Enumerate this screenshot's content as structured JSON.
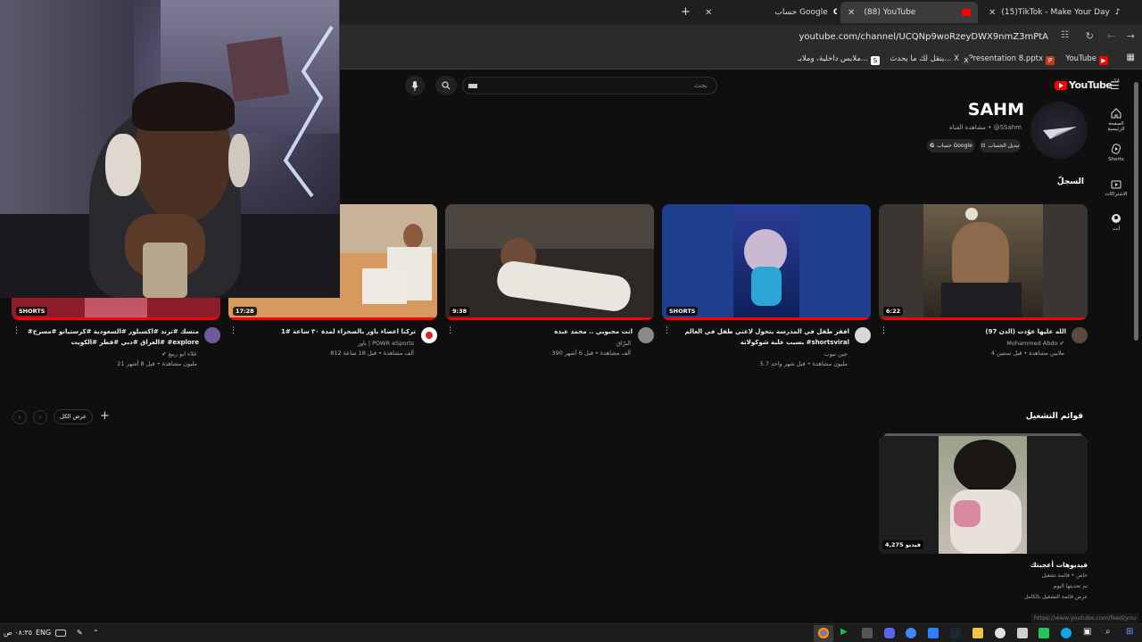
{
  "browser": {
    "tabs": [
      {
        "title": "(15)TikTok - Make Your Day",
        "active": false
      },
      {
        "title": "(88) YouTube",
        "active": true
      },
      {
        "title": "حساب Google",
        "active": false
      }
    ],
    "new_tab": "+",
    "url": "youtube.com/channel/UCQNp9woRzeyDWX9nmZ3mPtA",
    "bookmarks": [
      {
        "label": "YouTube",
        "icon": "youtube-icon"
      },
      {
        "label": "Presentation 8.pptx",
        "icon": "powerpoint-icon"
      },
      {
        "label": "ينقل لك ما يحدث... X",
        "icon": "x-icon"
      },
      {
        "label": "ملابس داخلية، وملابـ...",
        "icon": "s-icon"
      }
    ]
  },
  "youtube": {
    "logo": "YouTube",
    "logo_region": "SA",
    "search_placeholder": "بحث"
  },
  "sidebar": [
    {
      "label": "الصفحة الرئيسية",
      "icon": "home-icon"
    },
    {
      "label": "Shorts",
      "icon": "shorts-icon"
    },
    {
      "label": "الاشتراكات",
      "icon": "subscriptions-icon"
    },
    {
      "label": "أنت",
      "icon": "you-icon"
    }
  ],
  "channel": {
    "name": "SAHM",
    "handle": "@SSahm",
    "view_channel": "مشاهدة القناة",
    "switch_account": "تبديل الحساب",
    "google_account": "حساب Google"
  },
  "history": {
    "title": "السجلّ",
    "videos": [
      {
        "title": "الله عليها عوّدت (الدن 97)",
        "channel": "Mohammed Abdo",
        "verified": true,
        "meta": "4 ملايين مشاهدة • قبل سنتين",
        "duration": "6:22",
        "progress": 1.0
      },
      {
        "title": "افقر طفل في المدرسة يتحول لاغني طفل في العالم بسبب علبة شوكولاتة #shortsviral",
        "channel": "جين تيوب",
        "verified": false,
        "meta": "5.7 مليون مشاهدة • قبل شهر واحد",
        "duration": "SHORTS",
        "progress": 1.0
      },
      {
        "title": "انت محبوبي .. محمد عبده",
        "channel": "البرّاق",
        "verified": false,
        "meta": "390 ألف مشاهدة • قبل 6 أشهر",
        "duration": "9:38",
        "progress": 1.0
      },
      {
        "title": "تركنا اعضاء باور بالصحراء لمدة ٣٠ ساعة #1",
        "channel": "باور | POWR eSports",
        "verified": false,
        "meta": "812 ألف مشاهدة • قبل 18 ساعة",
        "duration": "17:28",
        "progress": 1.0
      },
      {
        "title": "#متسك #ترند #اكسبلور #السعودية #كرستيانو #مسرح #العراق #دبي #قطر #الكويت #explore",
        "channel": "علاء ابو ربيع",
        "verified": true,
        "meta": "21 مليون مشاهدة • قبل 8 أشهر",
        "duration": "SHORTS",
        "progress": 1.0
      }
    ]
  },
  "playlists": {
    "title": "قوائم التشغيل",
    "view_all": "عرض الكل",
    "add": "+",
    "items": [
      {
        "title": "فيديوهات أعجبتك",
        "meta1": "خاص • قائمة تشغيل",
        "meta2": "تم تحديثها اليوم",
        "link": "عرض قائمة التشغيل بالكامل",
        "count": "4,275 فيديو"
      }
    ]
  },
  "status_url": "https://www.youtube.com/feed/you",
  "taskbar": {
    "time": "٠٨:٣٥ ص",
    "lang": "ENG"
  },
  "colors": {
    "youtube_red": "#ff0000",
    "background": "#0f0f0f"
  }
}
